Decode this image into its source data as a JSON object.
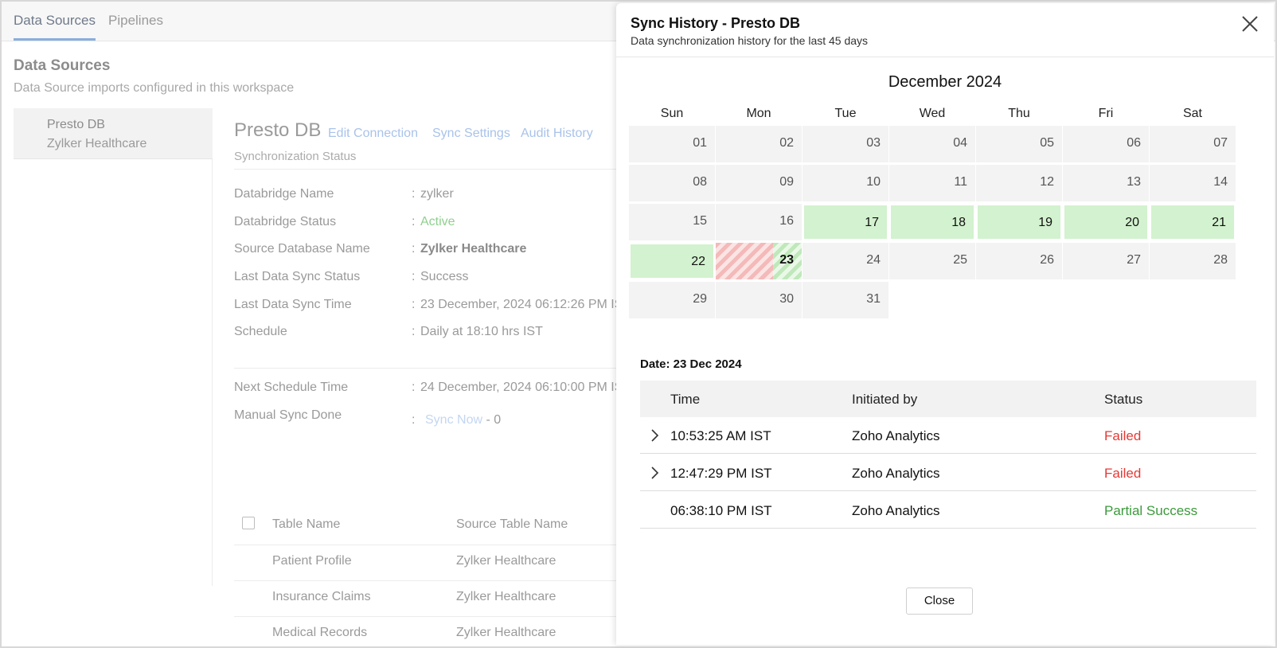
{
  "tabs": [
    {
      "label": "Data Sources"
    },
    {
      "label": "Pipelines"
    }
  ],
  "page": {
    "title": "Data Sources",
    "subtitle": "Data Source imports configured in this workspace"
  },
  "left_list": {
    "item_title": "Presto DB",
    "item_subtitle": "Zylker Healthcare"
  },
  "source": {
    "name": "Presto DB",
    "links": [
      "Edit Connection",
      "Sync Settings",
      "Audit History"
    ],
    "section": "Synchronization Status",
    "info": [
      {
        "label": "Databridge Name",
        "value": "zylker"
      },
      {
        "label": "Databridge Status",
        "value": "Active"
      },
      {
        "label": "Source Database Name",
        "value": "Zylker Healthcare"
      },
      {
        "label": "Last Data Sync Status",
        "value": "Success"
      },
      {
        "label": "Last Data Sync Time",
        "value": "23 December, 2024 06:12:26 PM IS"
      },
      {
        "label": "Schedule",
        "value": "Daily at 18:10 hrs IST"
      },
      {
        "label": "Next Schedule Time",
        "value": "24 December, 2024 06:10:00 PM IS"
      },
      {
        "label": "Manual Sync Done",
        "value": "- 0",
        "link": "Sync Now"
      }
    ],
    "colon": ":"
  },
  "table": {
    "headers": [
      "Table Name",
      "Source Table Name"
    ],
    "rows": [
      [
        "Patient Profile",
        "Zylker Healthcare"
      ],
      [
        "Insurance Claims",
        "Zylker Healthcare"
      ],
      [
        "Medical Records",
        "Zylker Healthcare"
      ]
    ]
  },
  "dialog": {
    "title": "Sync History - Presto DB",
    "subtitle": "Data synchronization history for the last 45 days",
    "close_icon": "close-icon",
    "calendar": {
      "month": "December 2024",
      "days_of_week": [
        "Sun",
        "Mon",
        "Tue",
        "Wed",
        "Thu",
        "Fri",
        "Sat"
      ],
      "weeks": [
        [
          "01",
          "02",
          "03",
          "04",
          "05",
          "06",
          "07"
        ],
        [
          "08",
          "09",
          "10",
          "11",
          "12",
          "13",
          "14"
        ],
        [
          "15",
          "16",
          "17",
          "18",
          "19",
          "20",
          "21"
        ],
        [
          "22",
          "23",
          "24",
          "25",
          "26",
          "27",
          "28"
        ],
        [
          "29",
          "30",
          "31"
        ]
      ],
      "success_days": [
        "17",
        "18",
        "19",
        "20",
        "21",
        "22"
      ],
      "partial_day": "23",
      "success_color": "#d3f2cf",
      "failed_color": "#f4b9b9"
    },
    "date_label": "Date: 23 Dec 2024",
    "history": {
      "headers": [
        "Time",
        "Initiated by",
        "Status"
      ],
      "rows": [
        {
          "time": "10:53:25 AM IST",
          "by": "Zoho Analytics",
          "status": "Failed",
          "expandable": true
        },
        {
          "time": "12:47:29 PM IST",
          "by": "Zoho Analytics",
          "status": "Failed",
          "expandable": true
        },
        {
          "time": "06:38:10 PM IST",
          "by": "Zoho Analytics",
          "status": "Partial Success",
          "expandable": false
        }
      ]
    },
    "close_button": "Close"
  }
}
